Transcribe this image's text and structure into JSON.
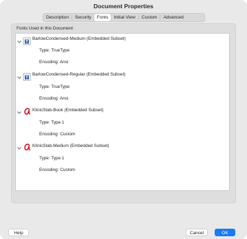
{
  "window": {
    "title": "Document Properties"
  },
  "tabs": [
    {
      "label": "Description",
      "active": false
    },
    {
      "label": "Security",
      "active": false
    },
    {
      "label": "Fonts",
      "active": true
    },
    {
      "label": "Initial View",
      "active": false
    },
    {
      "label": "Custom",
      "active": false
    },
    {
      "label": "Advanced",
      "active": false
    }
  ],
  "fonts_panel": {
    "section_label": "Fonts Used in this Document",
    "fonts": [
      {
        "name": "BarlowCondensed-Medium (Embedded Subset)",
        "icon": "truetype-font-icon",
        "type": "Type: TrueType",
        "encoding": "Encoding: Ansi"
      },
      {
        "name": "BarlowCondensed-Regular (Embedded Subset)",
        "icon": "truetype-font-icon",
        "type": "Type: TrueType",
        "encoding": "Encoding: Ansi"
      },
      {
        "name": "KlinicSlab-Book (Embedded Subset)",
        "icon": "type1-font-icon",
        "type": "Type: Type 1",
        "encoding": "Encoding: Custom"
      },
      {
        "name": "KlinicSlab-Medium (Embedded Subset)",
        "icon": "type1-font-icon",
        "type": "Type: Type 1",
        "encoding": "Encoding: Custom"
      }
    ]
  },
  "footer": {
    "help_label": "Help",
    "cancel_label": "Cancel",
    "ok_label": "OK"
  },
  "colors": {
    "accent": "#1a7cf0",
    "type1_icon": "#d0121c",
    "truetype_icon": "#2a5fb0"
  }
}
